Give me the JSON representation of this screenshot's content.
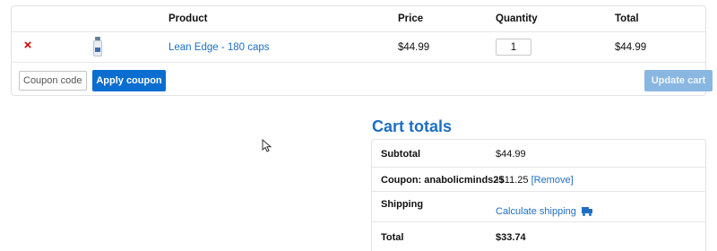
{
  "cart": {
    "headers": {
      "product": "Product",
      "price": "Price",
      "quantity": "Quantity",
      "total": "Total"
    },
    "items": [
      {
        "remove_icon": "close-icon",
        "remove_glyph": "×",
        "thumbnail_icon": "supplement-bottle-icon",
        "product_name": "Lean Edge - 180 caps",
        "price": "$44.99",
        "quantity": "1",
        "total": "$44.99"
      }
    ],
    "coupon_placeholder": "Coupon code",
    "apply_coupon_label": "Apply coupon",
    "update_cart_label": "Update cart"
  },
  "totals": {
    "title": "Cart totals",
    "subtotal_label": "Subtotal",
    "subtotal_value": "$44.99",
    "coupon_label": "Coupon: anabolicminds25",
    "coupon_value": "-$11.25",
    "coupon_remove": "[Remove]",
    "shipping_label": "Shipping",
    "shipping_link": "Calculate shipping",
    "shipping_icon": "truck-icon",
    "total_label": "Total",
    "total_value": "$33.74"
  },
  "colors": {
    "accent": "#1e6fc2",
    "primary_button": "#0a6ed1",
    "disabled_button": "#8ab7e2",
    "remove": "#d10000"
  }
}
